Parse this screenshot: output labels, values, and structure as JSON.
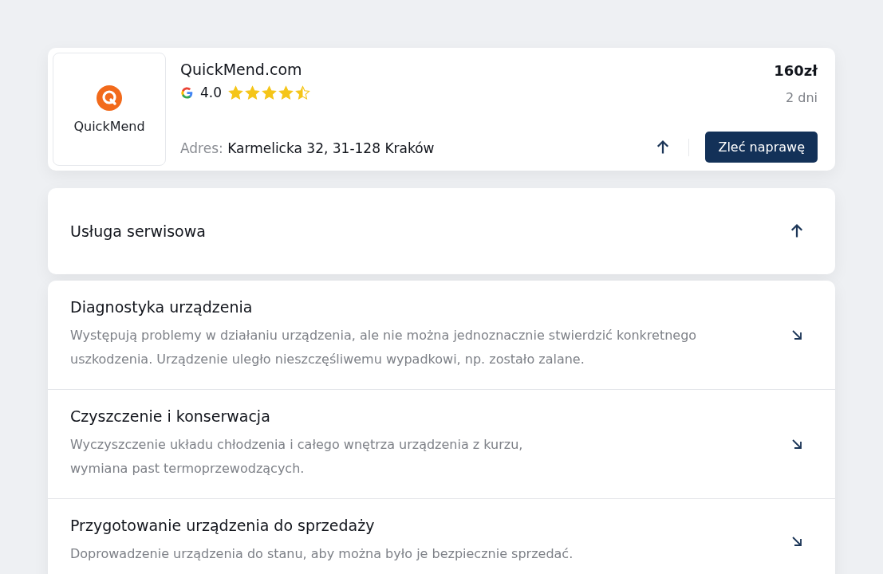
{
  "provider": {
    "logo_text": "QuickMend",
    "name": "QuickMend.com",
    "rating": "4.0",
    "stars": 4.5,
    "address_label": "Adres:",
    "address": "Karmelicka 32, 31-128 Kraków",
    "price": "160zł",
    "duration": "2 dni",
    "order_button": "Zleć naprawę",
    "expanded": true
  },
  "service_section": {
    "title": "Usługa serwisowa",
    "expanded": true
  },
  "services": [
    {
      "title": "Diagnostyka urządzenia",
      "description": "Występują problemy w działaniu urządzenia, ale nie można jednoznacznie stwierdzić konkretnego uszkodzenia. Urządzenie uległo nieszczęśliwemu wypadkowi, np. zostało zalane."
    },
    {
      "title": "Czyszczenie i konserwacja",
      "description": "Wyczyszczenie układu chłodzenia i całego wnętrza urządzenia z kurzu, wymiana past termoprzewodzących."
    },
    {
      "title": "Przygotowanie urządzenia do sprzedaży",
      "description": "Doprowadzenie urządzenia do stanu, aby można było je bezpiecznie sprzedać."
    }
  ]
}
